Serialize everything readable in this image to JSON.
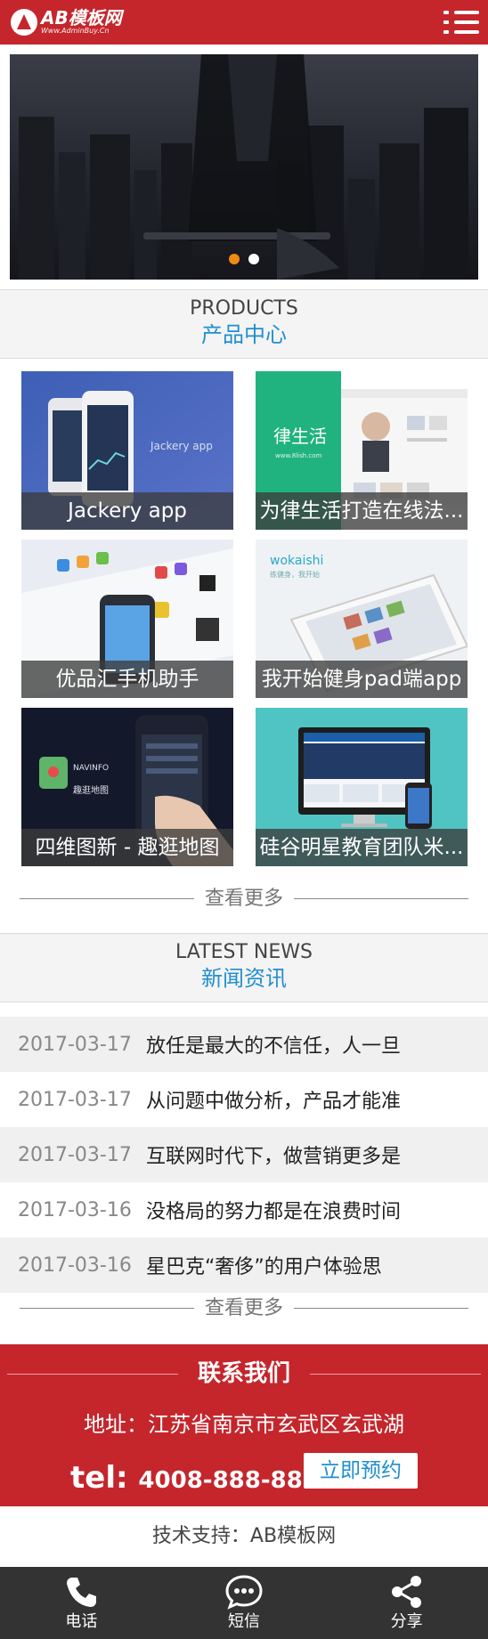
{
  "header": {
    "logo_title": "AB模板网",
    "logo_subtitle": "Www.AdminBuy.Cn"
  },
  "banner": {
    "dots": 2,
    "active_dot": 0
  },
  "products": {
    "title_en": "PRODUCTS",
    "title_cn": "产品中心",
    "items": [
      {
        "label": "Jackery app",
        "overlay_text": "Jackery app"
      },
      {
        "label": "为律生活打造在线法...",
        "overlay_text": "律生活",
        "overlay_sub": "www.8lish.com"
      },
      {
        "label": "优品汇手机助手"
      },
      {
        "label": "我开始健身pad端app",
        "overlay_text": "wokaishi",
        "overlay_sub": "练健身，我开始"
      },
      {
        "label": "四维图新 - 趣逛地图",
        "overlay_text": "NAVINFO",
        "overlay_sub": "趣逛地图"
      },
      {
        "label": "硅谷明星教育团队米..."
      }
    ],
    "more_label": "查看更多"
  },
  "news": {
    "title_en": "LATEST NEWS",
    "title_cn": "新闻资讯",
    "items": [
      {
        "date": "2017-03-17",
        "title": "放任是最大的不信任，人一旦"
      },
      {
        "date": "2017-03-17",
        "title": "从问题中做分析，产品才能准"
      },
      {
        "date": "2017-03-17",
        "title": "互联网时代下，做营销更多是"
      },
      {
        "date": "2017-03-16",
        "title": "没格局的努力都是在浪费时间"
      },
      {
        "date": "2017-03-16",
        "title": "星巴克“奢侈”的用户体验思"
      }
    ],
    "more_label": "查看更多"
  },
  "contact": {
    "heading": "联系我们",
    "address": "地址：江苏省南京市玄武区玄武湖",
    "tel_label": "tel:",
    "tel_number": "4008-888-888",
    "book_button": "立即预约"
  },
  "support": "技术支持：AB模板网",
  "bottom_bar": {
    "items": [
      {
        "label": "电话",
        "icon": "phone-icon"
      },
      {
        "label": "短信",
        "icon": "chat-icon"
      },
      {
        "label": "分享",
        "icon": "share-icon"
      }
    ]
  },
  "colors": {
    "brand_red": "#c4262c",
    "accent_blue": "#1f8fd0",
    "active_dot": "#f08a14",
    "bottom_bar": "#333333"
  }
}
